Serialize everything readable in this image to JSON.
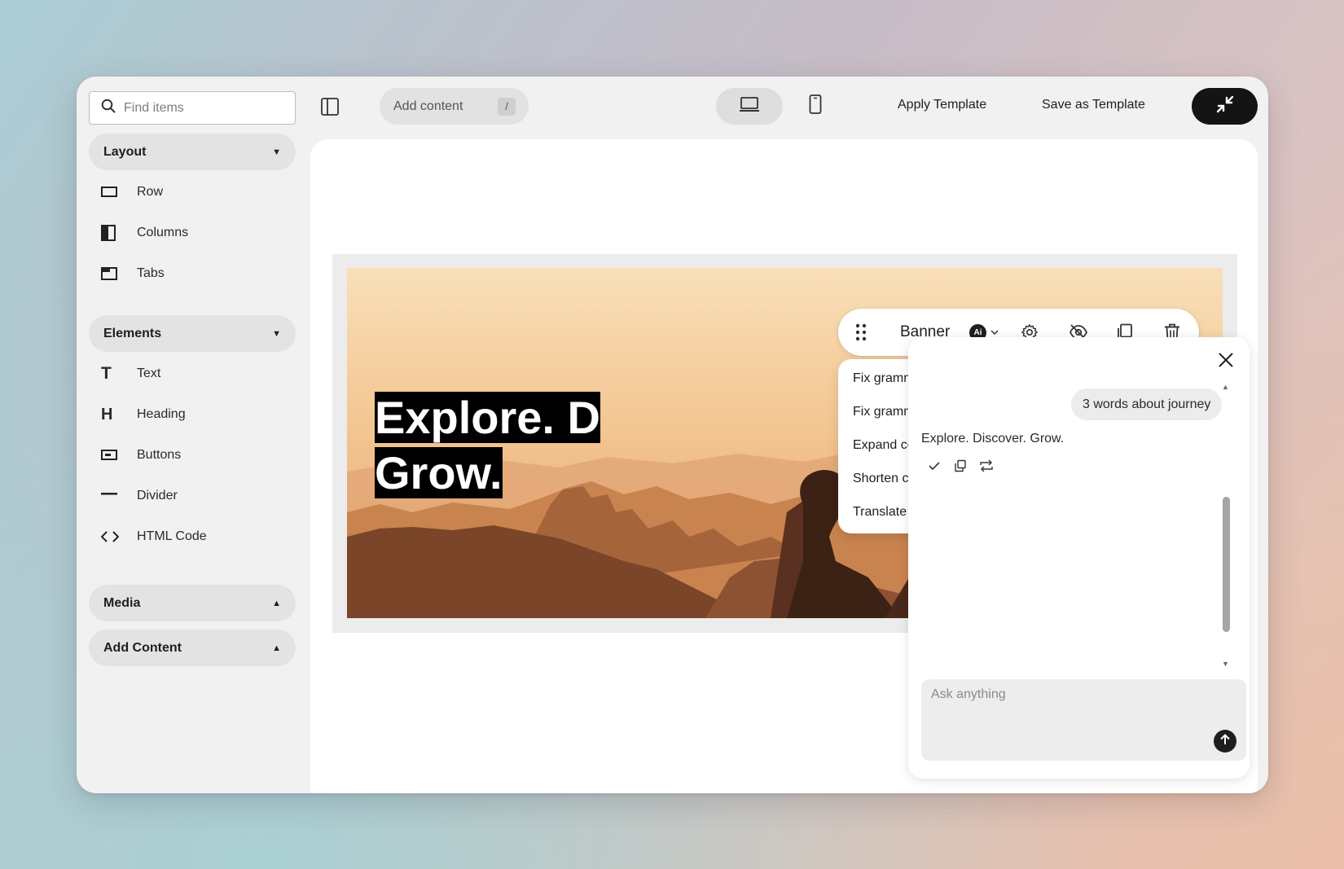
{
  "sidebar": {
    "search": {
      "placeholder": "Find items",
      "value": ""
    },
    "sections": [
      {
        "title": "Layout",
        "state": "expanded",
        "items": [
          {
            "label": "Row",
            "icon": "row-icon"
          },
          {
            "label": "Columns",
            "icon": "columns-icon"
          },
          {
            "label": "Tabs",
            "icon": "tabs-icon"
          }
        ]
      },
      {
        "title": "Elements",
        "state": "expanded",
        "items": [
          {
            "label": "Text",
            "icon": "text-T-icon"
          },
          {
            "label": "Heading",
            "icon": "heading-H-icon"
          },
          {
            "label": "Buttons",
            "icon": "button-icon"
          },
          {
            "label": "Divider",
            "icon": "divider-icon"
          },
          {
            "label": "HTML Code",
            "icon": "code-icon"
          }
        ]
      },
      {
        "title": "Media",
        "state": "collapsed"
      },
      {
        "title": "Add Content",
        "state": "collapsed"
      }
    ]
  },
  "topbar": {
    "toggle_sidebar_icon": "sidebar-panel-icon",
    "add_content": {
      "label": "Add content",
      "shortcut": "/"
    },
    "device_desktop_icon": "laptop-icon",
    "device_mobile_icon": "mobile-icon",
    "apply_template": "Apply Template",
    "save_as_template": "Save as Template",
    "collapse_icon": "minimize-arrows-icon"
  },
  "canvas": {
    "banner": {
      "headline_line1": "Explore. D",
      "headline_line2": "Grow."
    },
    "block_toolbar": {
      "drag_icon": "drag-handle-icon",
      "label": "Banner",
      "ai_badge": "Ai",
      "settings_icon": "gear-icon",
      "visibility_icon": "eye-off-icon",
      "duplicate_icon": "copy-icon",
      "delete_icon": "trash-icon"
    },
    "ai_menu": [
      "Fix grammar",
      "Fix grammar and improve writing",
      "Expand content",
      "Shorten content",
      "Translate to English (en_US)"
    ]
  },
  "ai_panel": {
    "user_message": "3 words about journey",
    "assistant_reply": "Explore. Discover. Grow.",
    "actions": [
      "check-icon",
      "copy-icon",
      "regenerate-icon"
    ],
    "input_placeholder": "Ask anything",
    "send_icon": "arrow-up-icon"
  },
  "colors": {
    "accent_dark": "#141414",
    "panel_bg": "#f1f1f1",
    "section_bg": "#e3e3e3"
  }
}
